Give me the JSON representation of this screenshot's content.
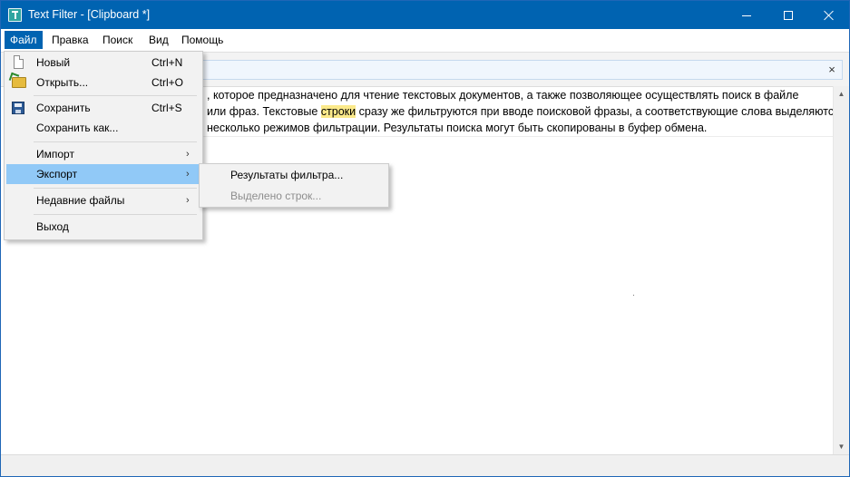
{
  "window": {
    "title": "Text Filter - [Clipboard *]",
    "accent_color": "#0063b1",
    "controls": {
      "minimize_icon": "minimize-icon",
      "maximize_icon": "maximize-icon",
      "close_icon": "close-icon"
    }
  },
  "menubar": {
    "items": [
      {
        "label": "Файл",
        "active": true
      },
      {
        "label": "Правка"
      },
      {
        "label": "Поиск"
      },
      {
        "label": "Вид"
      },
      {
        "label": "Помощь"
      }
    ]
  },
  "search": {
    "value": "",
    "clear_label": "×"
  },
  "document": {
    "line1_text": ", которое предназначено для чтение текстовых документов, а также позволяющее осуществлять поиск в файле",
    "line2_before": "или фраз. Текстовые ",
    "line2_highlight": "строки",
    "line2_after": " сразу же фильтруются при вводе поисковой фразы, а соответствующие слова выделяются",
    "line3_text": "несколько режимов фильтрации. Результаты поиска могут быть скопированы в буфер обмена.",
    "highlight_color": "#fbe98a"
  },
  "file_menu": {
    "new": {
      "label": "Новый",
      "shortcut": "Ctrl+N",
      "icon": "new-file-icon"
    },
    "open": {
      "label": "Открыть...",
      "shortcut": "Ctrl+O",
      "icon": "open-folder-icon"
    },
    "save": {
      "label": "Сохранить",
      "shortcut": "Ctrl+S",
      "icon": "save-icon"
    },
    "save_as": {
      "label": "Сохранить как..."
    },
    "import": {
      "label": "Импорт",
      "submenu_glyph": "›"
    },
    "export": {
      "label": "Экспорт",
      "submenu_glyph": "›",
      "highlighted": true
    },
    "recent": {
      "label": "Недавние файлы",
      "submenu_glyph": "›"
    },
    "exit": {
      "label": "Выход"
    },
    "hover_color": "#91c9f7"
  },
  "export_submenu": {
    "filter_results": {
      "label": "Результаты фильтра..."
    },
    "selected_lines": {
      "label": "Выделено строк...",
      "disabled": true
    }
  },
  "scrollbar": {
    "up_glyph": "▲",
    "down_glyph": "▼"
  }
}
